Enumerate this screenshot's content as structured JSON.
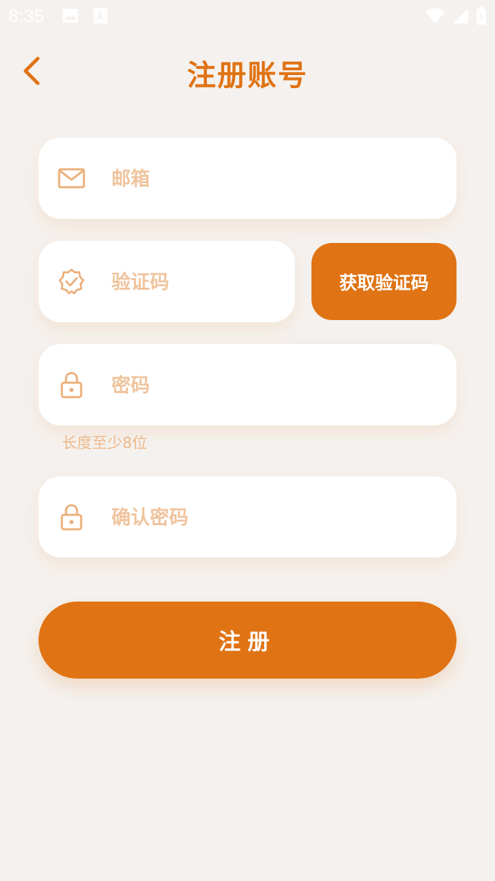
{
  "status_bar": {
    "time": "8:35",
    "icons": [
      "image-icon",
      "text-a-icon",
      "wifi-icon",
      "signal-icon",
      "battery-charging-icon"
    ]
  },
  "header": {
    "title": "注册账号",
    "back_icon": "chevron-left-icon"
  },
  "form": {
    "email": {
      "placeholder": "邮箱",
      "value": "",
      "icon": "mail-icon"
    },
    "code": {
      "placeholder": "验证码",
      "value": "",
      "icon": "verified-badge-icon"
    },
    "get_code_label": "获取验证码",
    "password": {
      "placeholder": "密码",
      "value": "",
      "icon": "lock-icon"
    },
    "password_hint": "长度至少8位",
    "confirm_password": {
      "placeholder": "确认密码",
      "value": "",
      "icon": "lock-icon"
    },
    "submit_label": "注册"
  },
  "colors": {
    "accent": "#E07314",
    "placeholder": "#EFC49D",
    "background": "#F5F1EE",
    "field_bg": "#FFFFFF"
  }
}
